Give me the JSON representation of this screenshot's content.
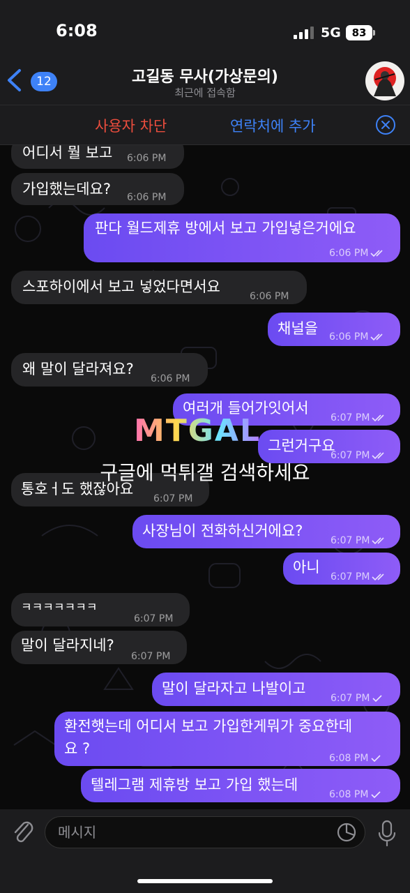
{
  "status_bar": {
    "time": "6:08",
    "network": "5G",
    "battery": "83"
  },
  "header": {
    "back_count": "12",
    "title": "고길동 무사(가상문의)",
    "subtitle": "최근에 접속함"
  },
  "action_bar": {
    "block_label": "사용자 차단",
    "add_contact_label": "연락처에 추가"
  },
  "messages": [
    {
      "dir": "in",
      "text": "어디서 뭘 보고",
      "time": "6:06 PM"
    },
    {
      "dir": "in",
      "text": "가입했는데요?",
      "time": "6:06 PM"
    },
    {
      "dir": "out",
      "text": "판다 월드제휴 방에서 보고 가입넣은거에요",
      "time": "6:06 PM",
      "read": true
    },
    {
      "dir": "in",
      "text": "스포하이에서 보고 넣었다면서요",
      "time": "6:06 PM"
    },
    {
      "dir": "out",
      "text": "채널을",
      "time": "6:06 PM",
      "read": true
    },
    {
      "dir": "in",
      "text": "왜 말이 달라져요?",
      "time": "6:06 PM"
    },
    {
      "dir": "out",
      "text": "여러개 들어가잇어서",
      "time": "6:07 PM",
      "read": true
    },
    {
      "dir": "out",
      "text": "그런거구요",
      "time": "6:07 PM",
      "read": true
    },
    {
      "dir": "in",
      "text": "통호ㅓ도 했잖아요",
      "time": "6:07 PM"
    },
    {
      "dir": "out",
      "text": "사장님이 전화하신거에요?",
      "time": "6:07 PM",
      "read": true
    },
    {
      "dir": "out",
      "text": "아니",
      "time": "6:07 PM",
      "read": true
    },
    {
      "dir": "in",
      "text": "ㅋㅋㅋㅋㅋㅋㅋ",
      "time": "6:07 PM"
    },
    {
      "dir": "in",
      "text": "말이 달라지네?",
      "time": "6:07 PM"
    },
    {
      "dir": "out",
      "text": "말이 달라자고 나발이고",
      "time": "6:07 PM",
      "read": false
    },
    {
      "dir": "out",
      "text": "환전햇는데 어디서 보고 가입한게뭐가 중요한데",
      "text2": "요 ?",
      "time": "6:08 PM",
      "read": false
    },
    {
      "dir": "out",
      "text": "텔레그램 제휴방 보고 가입 했는데",
      "time": "6:08 PM",
      "read": false
    }
  ],
  "watermark": {
    "logo": "MTGAL",
    "text": "구글에 먹튀갤 검색하세요"
  },
  "composer": {
    "placeholder": "메시지"
  },
  "colors": {
    "outgoing_start": "#6b4bf1",
    "outgoing_end": "#8e5cf7",
    "incoming": "#252527",
    "accent_blue": "#3e82f7",
    "block_red": "#eb4d3d"
  }
}
